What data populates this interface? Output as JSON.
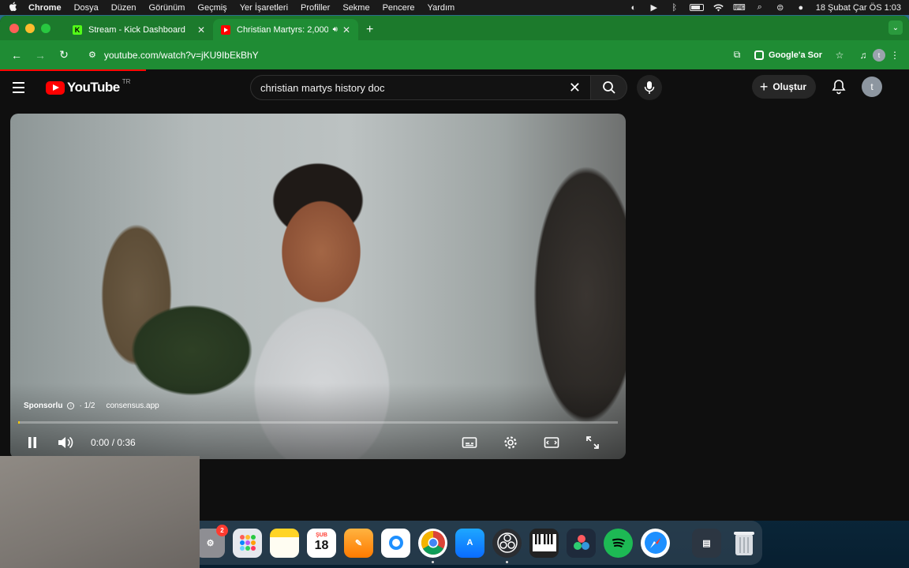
{
  "menubar": {
    "app_name": "Chrome",
    "items": [
      "Dosya",
      "Düzen",
      "Görünüm",
      "Geçmiş",
      "Yer İşaretleri",
      "Profiller",
      "Sekme",
      "Pencere",
      "Yardım"
    ],
    "clock": "18 Şubat Çar ÖS  1:03"
  },
  "browser": {
    "tabs": [
      {
        "title": "Stream - Kick Dashboard",
        "favicon": "kick-icon"
      },
      {
        "title": "Christian Martyrs: 2,000 Y",
        "favicon": "youtube-icon"
      }
    ],
    "url": "youtube.com/watch?v=jKU9IbEkBhY",
    "lens_label": "Google'a Sor",
    "profile_initial": "t"
  },
  "youtube": {
    "wordmark": "YouTube",
    "region": "TR",
    "search_query": "christian martys history doc",
    "create_label": "Oluştur",
    "avatar_initial": "t"
  },
  "player": {
    "sponsored_label": "Sponsorlu",
    "ad_position": "1/2",
    "ad_domain": "consensus.app",
    "time_display": "0:00 / 0:36",
    "progress_fraction": 0.0
  },
  "dock": {
    "settings_badge": "2",
    "calendar_month": "ŞUB",
    "calendar_day": "18"
  },
  "colors": {
    "browser_theme": "#1f8c34",
    "youtube_red": "#ff0000",
    "ad_progress": "#ffcc00"
  }
}
